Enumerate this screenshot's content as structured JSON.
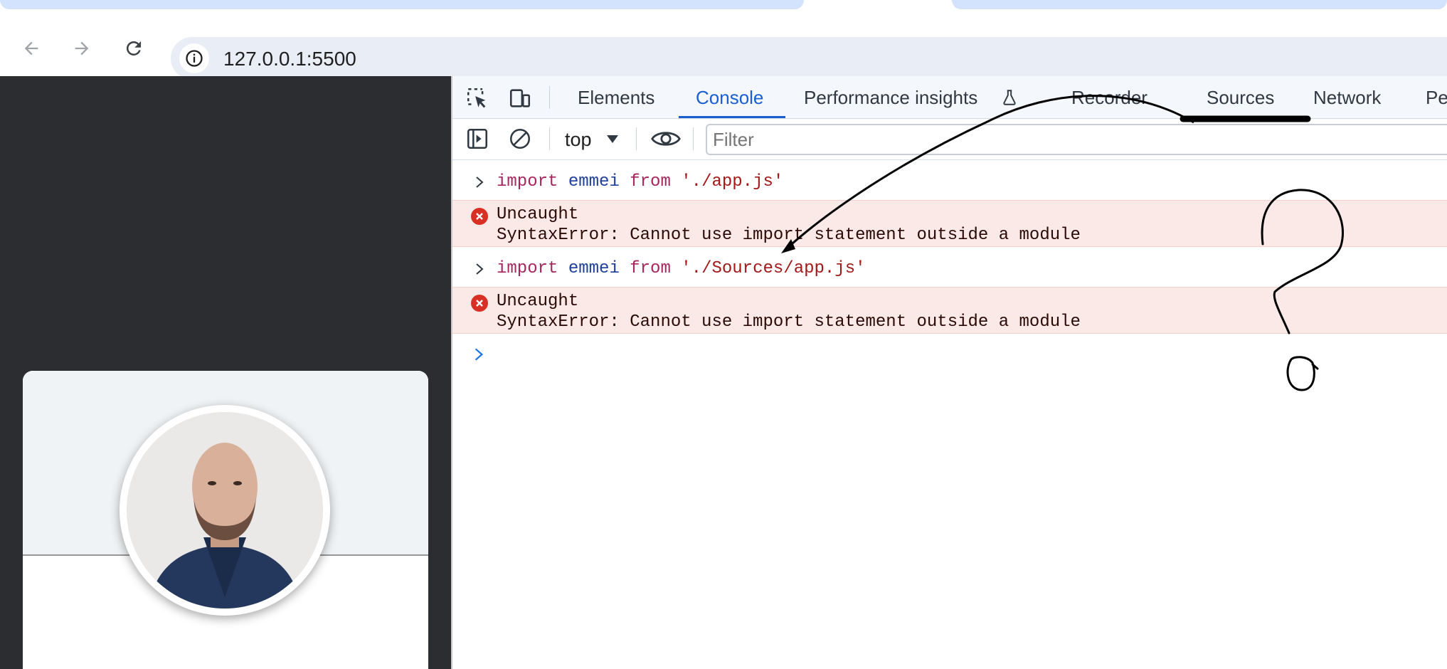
{
  "browser": {
    "url": "127.0.0.1:5500",
    "nav": {
      "back_icon": "arrow-left-icon",
      "forward_icon": "arrow-right-icon",
      "reload_icon": "reload-icon",
      "site_info_icon": "info-icon"
    }
  },
  "page": {
    "avatar_alt": "profile-photo"
  },
  "devtools": {
    "tabs": [
      {
        "label": "Elements"
      },
      {
        "label": "Console"
      },
      {
        "label": "Performance insights"
      },
      {
        "label": "Recorder"
      },
      {
        "label": "Sources"
      },
      {
        "label": "Network"
      },
      {
        "label": "Pe"
      }
    ],
    "active_tab": "Console",
    "context": "top",
    "filter_placeholder": "Filter",
    "messages": [
      {
        "type": "input",
        "kw": "import",
        "ident": "emmei",
        "from": "from",
        "str": "'./app.js'"
      },
      {
        "type": "error",
        "line1": "Uncaught",
        "line2": "SyntaxError: Cannot use import statement outside a module"
      },
      {
        "type": "input",
        "kw": "import",
        "ident": "emmei",
        "from": "from",
        "str": "'./Sources/app.js'"
      },
      {
        "type": "error",
        "line1": "Uncaught",
        "line2": "SyntaxError: Cannot use import statement outside a module"
      }
    ]
  },
  "colors": {
    "accent": "#1a5fd0",
    "error_bg": "#fbe9e7",
    "error_icon": "#d93025",
    "page_bg": "#2c2d31"
  }
}
